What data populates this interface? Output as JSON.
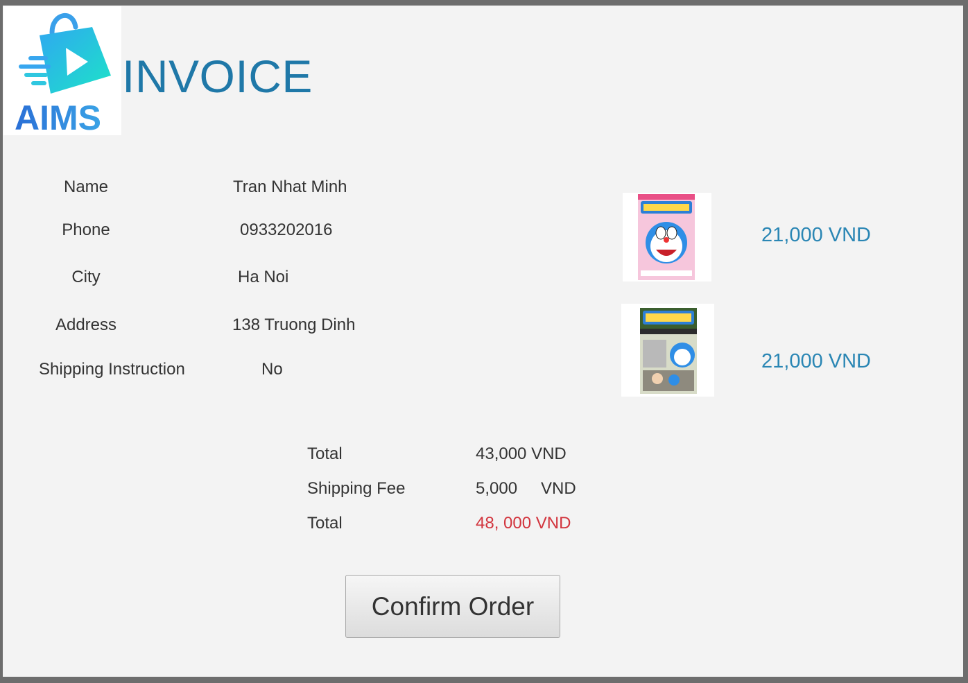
{
  "header": {
    "logo_text": "AIMS",
    "title": "INVOICE"
  },
  "customer": {
    "name_label": "Name",
    "name_value": "Tran Nhat Minh",
    "phone_label": "Phone",
    "phone_value": "0933202016",
    "city_label": "City",
    "city_value": "Ha Noi",
    "address_label": "Address",
    "address_value": "138 Truong Dinh",
    "instruction_label": "Shipping Instruction",
    "instruction_value": "No"
  },
  "items": [
    {
      "price": "21,000 VND",
      "cover": "doraemon-comic-cover-pink"
    },
    {
      "price": "21,000 VND",
      "cover": "doraemon-comic-cover-green"
    }
  ],
  "summary": {
    "subtotal_label": "Total",
    "subtotal_value": "43,000 VND",
    "shipping_label": "Shipping Fee",
    "shipping_value": "5,000",
    "shipping_unit": "VND",
    "total_label": "Total",
    "total_value": "48, 000 VND"
  },
  "actions": {
    "confirm_label": "Confirm Order"
  },
  "colors": {
    "title": "#1f78a8",
    "price": "#2a86b4",
    "total_highlight": "#d2343d",
    "background": "#f3f3f3"
  }
}
